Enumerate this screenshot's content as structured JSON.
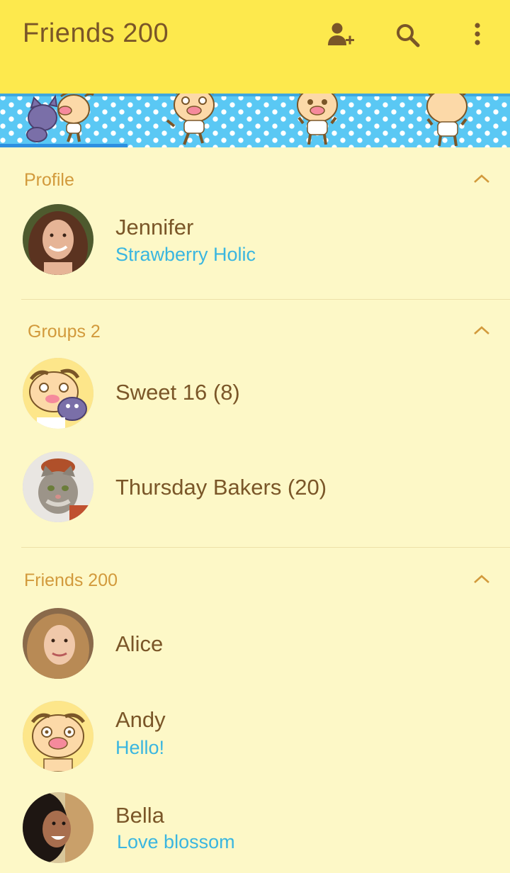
{
  "appbar": {
    "title": "Friends  200",
    "actions": {
      "add_friend_icon": "add-person-icon",
      "search_icon": "search-icon",
      "more_icon": "more-vert-icon"
    }
  },
  "colors": {
    "appbar_bg": "#fde94d",
    "page_bg": "#fdf8c7",
    "banner_bg": "#5ac8f4",
    "name_text": "#7a5628",
    "section_text": "#d29a3c",
    "status_text": "#3ab6e0"
  },
  "sections": {
    "profile": {
      "label": "Profile",
      "items": [
        {
          "name": "Jennifer",
          "status": "Strawberry Holic"
        }
      ]
    },
    "groups": {
      "label": "Groups 2",
      "items": [
        {
          "name": "Sweet 16 (8)"
        },
        {
          "name": "Thursday Bakers (20)"
        }
      ]
    },
    "friends": {
      "label": "Friends 200",
      "items": [
        {
          "name": "Alice"
        },
        {
          "name": "Andy",
          "status": "Hello!"
        },
        {
          "name": "Bella",
          "status": "Love blossom"
        }
      ]
    }
  }
}
